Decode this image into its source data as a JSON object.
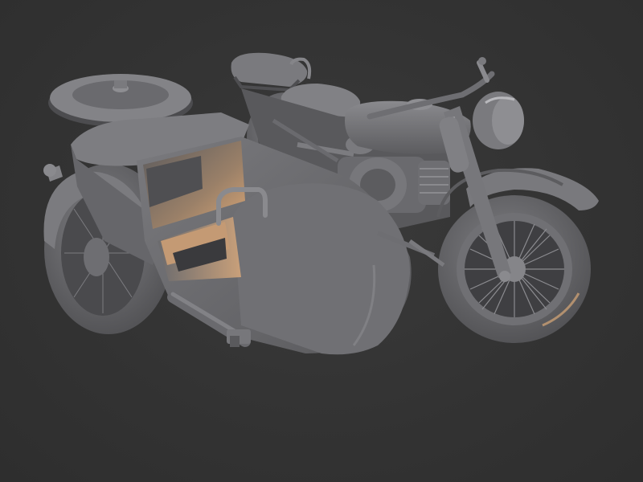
{
  "scene": {
    "subject": "motorcycle-with-sidecar-clay-render",
    "colors": {
      "background": "#333333",
      "body": "#6b6b6e",
      "body_light": "#8a8a8e",
      "body_dark": "#4a4a4d",
      "rim_light": "#e8b98a",
      "tire": "#5e5e61"
    }
  }
}
